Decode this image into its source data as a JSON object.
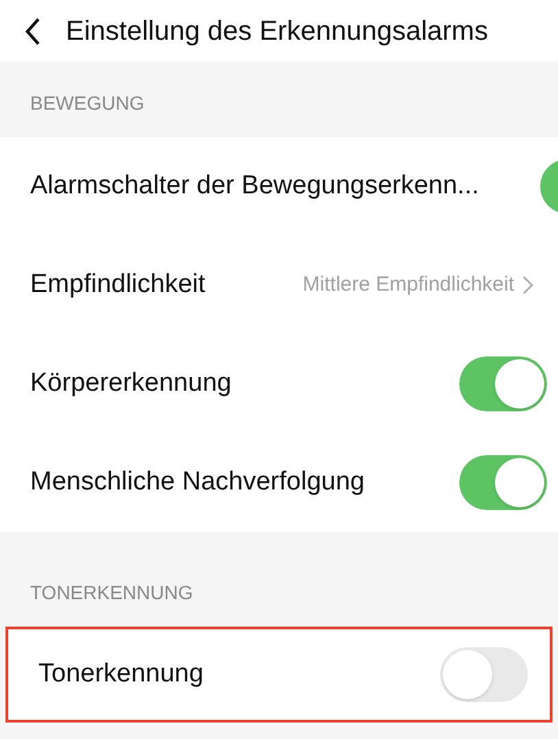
{
  "header": {
    "title": "Einstellung des Erkennungsalarms"
  },
  "sections": [
    {
      "heading": "BEWEGUNG",
      "items": [
        {
          "kind": "toggle",
          "label": "Alarmschalter der Bewegungserkenn...",
          "on": true,
          "highlighted": false
        },
        {
          "kind": "value",
          "label": "Empfindlichkeit",
          "value": "Mittlere Empfindlichkeit",
          "highlighted": false
        },
        {
          "kind": "toggle",
          "label": "Körpererkennung",
          "on": true,
          "highlighted": false
        },
        {
          "kind": "toggle",
          "label": "Menschliche Nachverfolgung",
          "on": true,
          "highlighted": false
        }
      ]
    },
    {
      "heading": "TONERKENNUNG",
      "items": [
        {
          "kind": "toggle",
          "label": "Tonerkennung",
          "on": false,
          "highlighted": true
        }
      ]
    }
  ]
}
